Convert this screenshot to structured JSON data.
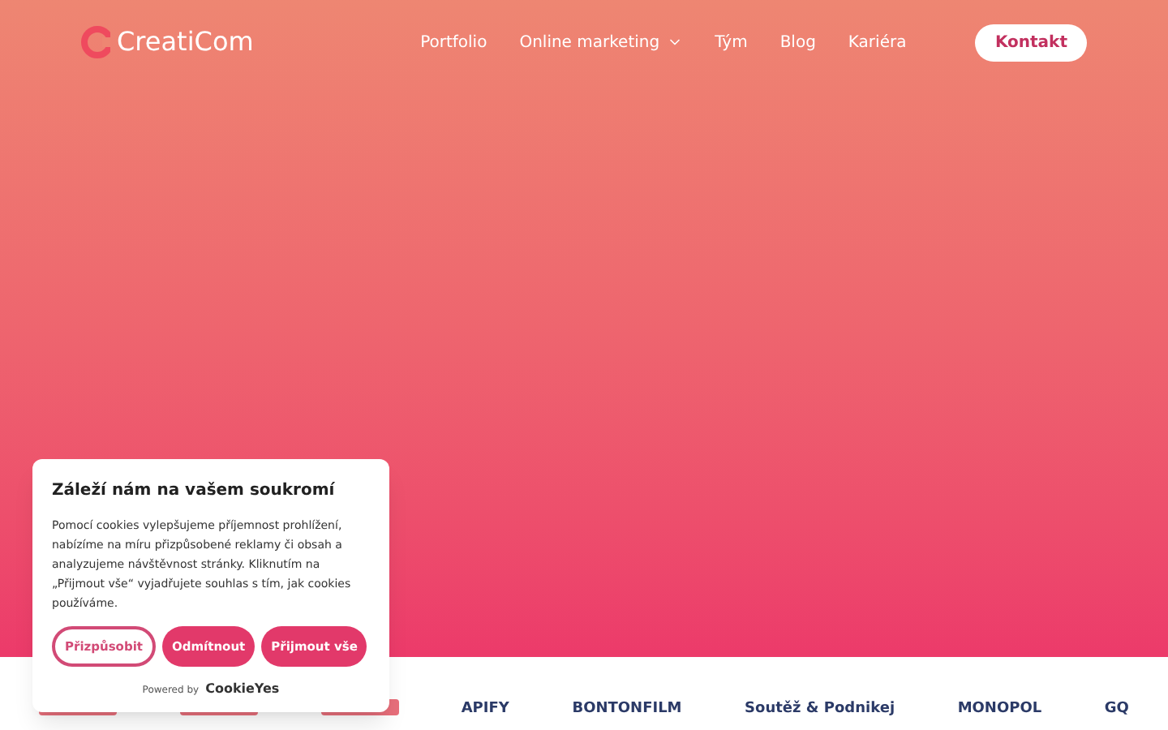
{
  "header": {
    "logo": "CreatiCom",
    "nav": [
      {
        "label": "Portfolio",
        "dropdown": false
      },
      {
        "label": "Online marketing",
        "dropdown": true
      },
      {
        "label": "Tým",
        "dropdown": false
      },
      {
        "label": "Blog",
        "dropdown": false
      },
      {
        "label": "Kariéra",
        "dropdown": false
      }
    ],
    "cta": "Kontakt"
  },
  "logos": [
    {
      "kind": "shape"
    },
    {
      "kind": "shape"
    },
    {
      "kind": "shape"
    },
    {
      "kind": "text",
      "text": "APIFY"
    },
    {
      "kind": "text",
      "text": "BONTONFILM"
    },
    {
      "kind": "text",
      "text": "Soutěž & Podnikej"
    },
    {
      "kind": "text",
      "text": "MONOPOL"
    },
    {
      "kind": "text",
      "text": "GQ"
    }
  ],
  "cookie_banner": {
    "title": "Záleží nám na vašem soukromí",
    "text": "Pomocí cookies vylepšujeme příjemnost prohlížení, nabízíme na míru přizpůsobené reklamy či obsah a analyzujeme návštěvnost stránky. Kliknutím na „Přijmout vše“ vyjadřujete souhlas s tím, jak cookies používáme.",
    "buttons": [
      {
        "label": "Přizpůsobit",
        "kind": "outline"
      },
      {
        "label": "Odmítnout",
        "kind": "filled"
      },
      {
        "label": "Přijmout vše",
        "kind": "filled"
      }
    ],
    "powered_by": "Powered by",
    "brand": "CookieYes"
  }
}
